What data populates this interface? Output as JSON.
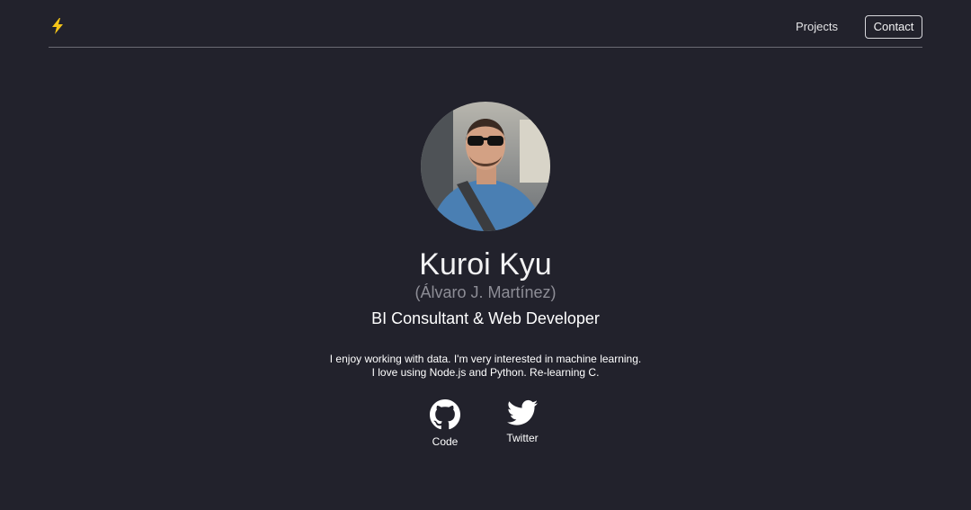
{
  "nav": {
    "logo_icon": "lightning-bolt-icon",
    "links": [
      {
        "label": "Projects"
      },
      {
        "label": "Contact"
      }
    ]
  },
  "profile": {
    "avatar_icon": "profile-photo",
    "name": "Kuroi Kyu",
    "real_name": "(Álvaro J. Martínez)",
    "role": "BI Consultant & Web Developer",
    "bio_lines": [
      "I enjoy working with data. I'm very interested in machine learning.",
      "I love using Node.js and Python. Re-learning C."
    ]
  },
  "social": [
    {
      "label": "Code",
      "icon": "github-icon"
    },
    {
      "label": "Twitter",
      "icon": "twitter-icon"
    }
  ],
  "colors": {
    "background": "#22222c",
    "accent": "#f5c518",
    "muted_text": "#8d8d96"
  }
}
